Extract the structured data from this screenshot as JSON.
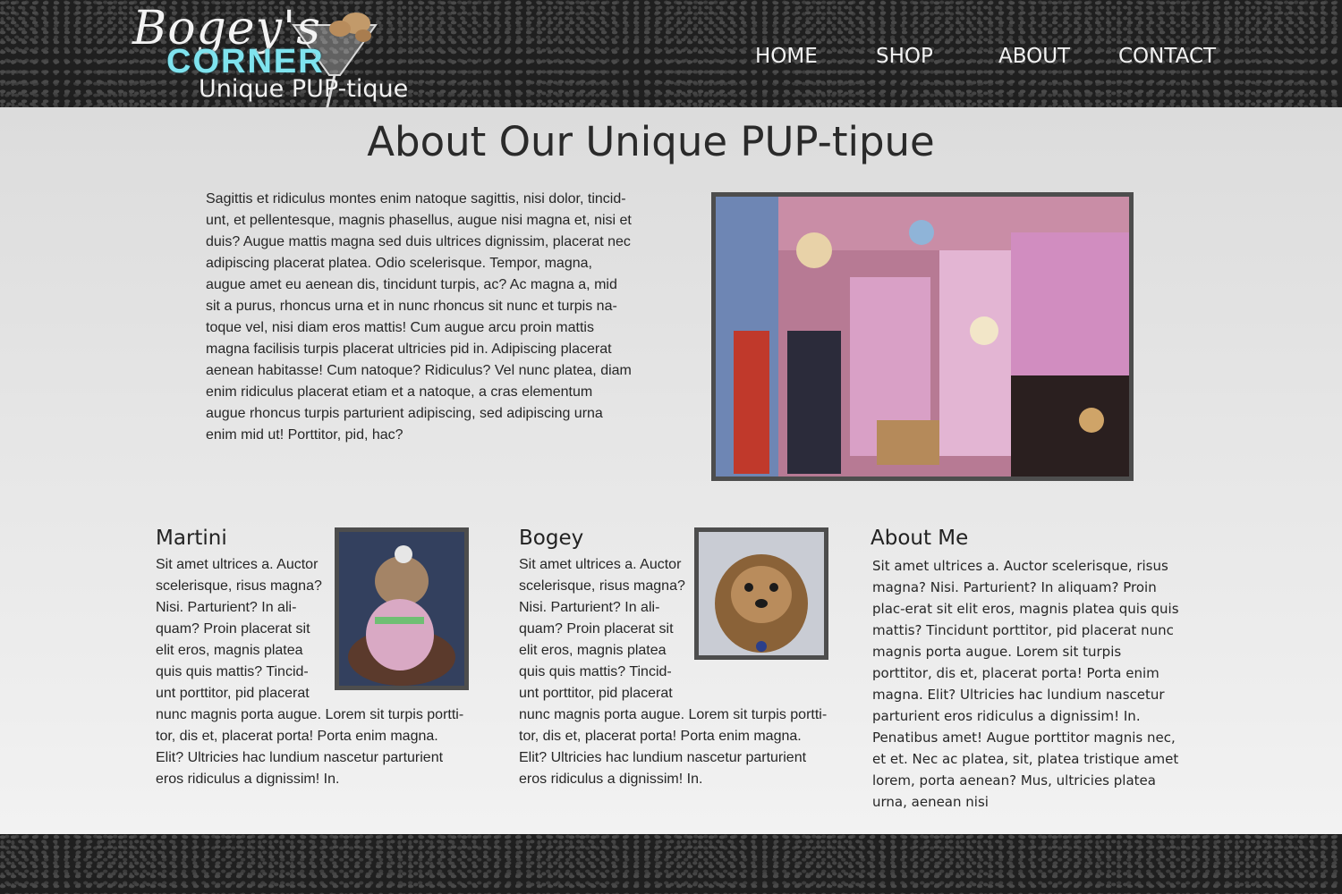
{
  "header": {
    "logo": {
      "script": "Bogey's",
      "corner": "CORNER",
      "tagline": "Unique PUP-tique"
    },
    "nav": [
      {
        "label": "HOME"
      },
      {
        "label": "SHOP"
      },
      {
        "label": "ABOUT"
      },
      {
        "label": "CONTACT"
      }
    ]
  },
  "main": {
    "title": "About Our Unique PUP-tipue",
    "intro": "Sagittis et ridiculus montes enim natoque sagittis, nisi dolor, tincid-unt, et pellentesque, magnis phasellus, augue nisi magna et, nisi et duis? Augue mattis magna sed duis ultrices dignissim, placerat nec adipiscing placerat platea. Odio scelerisque. Tempor, magna, augue amet eu aenean dis, tincidunt turpis, ac? Ac magna a, mid sit a purus, rhoncus urna et in nunc rhoncus sit nunc et turpis na-toque vel, nisi diam eros mattis! Cum augue arcu proin mattis magna facilisis turpis placerat ultricies pid in. Adipiscing placerat aenean habitasse! Cum natoque? Ridiculus? Vel nunc platea, diam enim ridiculus placerat etiam et a natoque, a cras elementum augue rhoncus turpis parturient adipiscing, sed adipiscing urna enim mid ut! Porttitor, pid, hac?",
    "columns": [
      {
        "heading": "Martini",
        "lines": [
          "Sit amet ultrices a. Auctor",
          "scelerisque, risus magna?",
          "Nisi. Parturient? In ali-",
          "quam? Proin placerat sit",
          "elit eros, magnis platea",
          "quis quis mattis? Tincid-",
          "unt porttitor, pid placerat",
          "nunc magnis porta augue. Lorem sit turpis portti-",
          "tor, dis et, placerat porta! Porta enim magna.",
          "Elit? Ultricies hac lundium nascetur parturient",
          "eros ridiculus a dignissim! In."
        ]
      },
      {
        "heading": "Bogey",
        "lines": [
          "Sit amet ultrices a. Auctor",
          "scelerisque, risus magna?",
          "Nisi. Parturient? In ali-",
          "quam? Proin placerat sit",
          "elit eros, magnis platea",
          "quis quis mattis? Tincid-",
          "unt porttitor, pid placerat",
          "nunc magnis porta augue. Lorem sit turpis portti-",
          "tor, dis et, placerat porta! Porta enim magna.",
          "Elit? Ultricies hac lundium nascetur parturient",
          "eros ridiculus a dignissim! In."
        ]
      },
      {
        "heading": "About Me",
        "text": "Sit amet ultrices a. Auctor scelerisque, risus magna? Nisi. Parturient? In aliquam? Proin plac-erat sit elit eros, magnis platea quis quis mattis? Tincidunt porttitor, pid placerat nunc magnis porta augue. Lorem sit turpis porttitor, dis et, placerat porta! Porta enim magna. Elit? Ultricies hac lundium nascetur parturient eros ridiculus a dignissim! In. Penatibus amet! Augue porttitor magnis nec, et et. Nec ac platea, sit, platea tristique amet lorem, porta aenean? Mus, ultricies platea urna, aenean nisi"
      }
    ]
  },
  "colors": {
    "header_bg": "#1f1f1f",
    "accent": "#7fe3ee",
    "frame": "#4d4d4d"
  }
}
